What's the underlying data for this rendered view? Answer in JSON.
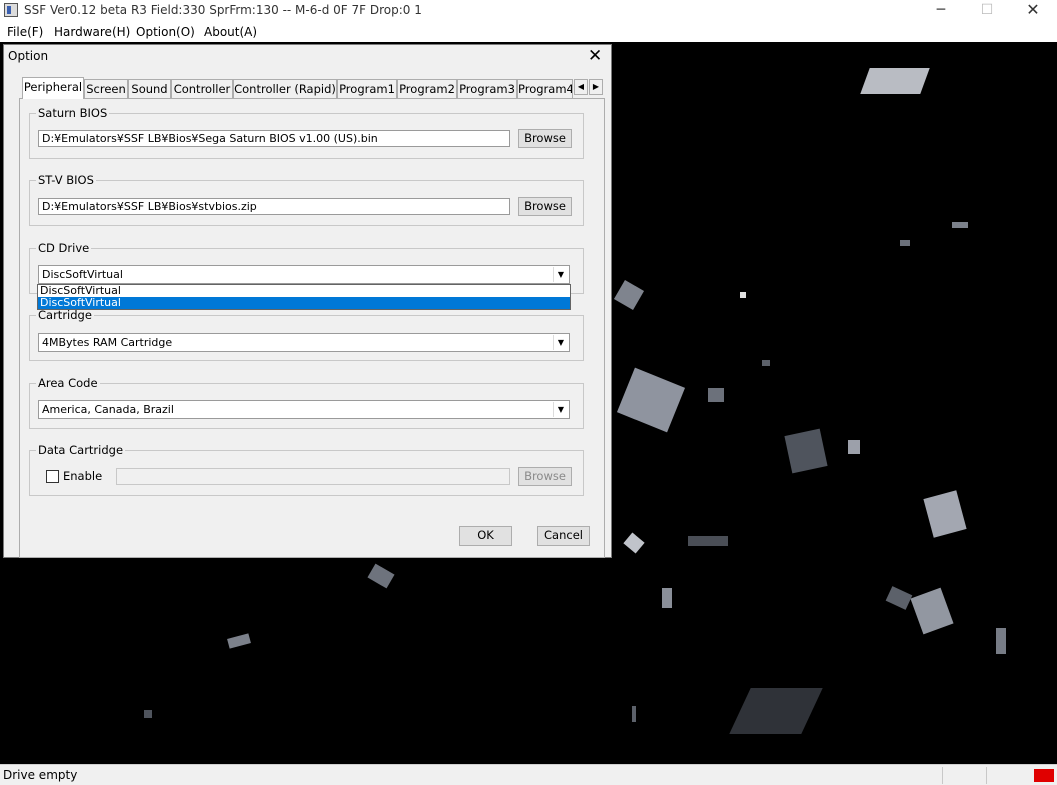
{
  "window": {
    "title": "SSF Ver0.12 beta R3  Field:330  SprFrm:130  -- M-6-d  0F 7F  Drop:0 1",
    "minimize": "─",
    "maximize": "☐",
    "close": "✕"
  },
  "menu": [
    "File(F)",
    "Hardware(H)",
    "Option(O)",
    "About(A)"
  ],
  "dialog": {
    "title": "Option",
    "close": "✕",
    "tabs": [
      "Peripheral",
      "Screen",
      "Sound",
      "Controller",
      "Controller (Rapid)",
      "Program1",
      "Program2",
      "Program3",
      "Program4"
    ],
    "active_tab": "Peripheral",
    "saturn_bios": {
      "label": "Saturn BIOS",
      "path": "D:¥Emulators¥SSF LB¥Bios¥Sega Saturn BIOS v1.00 (US).bin",
      "browse": "Browse"
    },
    "stv_bios": {
      "label": "ST-V BIOS",
      "path": "D:¥Emulators¥SSF LB¥Bios¥stvbios.zip",
      "browse": "Browse"
    },
    "cd_drive": {
      "label": "CD Drive",
      "value": "DiscSoftVirtual",
      "options": [
        "DiscSoftVirtual",
        "DiscSoftVirtual"
      ]
    },
    "cartridge": {
      "label": "Cartridge",
      "value": "4MBytes RAM Cartridge"
    },
    "area_code": {
      "label": "Area Code",
      "value": "America, Canada, Brazil"
    },
    "data_cartridge": {
      "label": "Data Cartridge",
      "enable_label": "Enable",
      "enabled": false,
      "path": "",
      "browse": "Browse"
    },
    "ok": "OK",
    "cancel": "Cancel"
  },
  "status": {
    "text": "Drive empty",
    "indicator_color": "#e00000"
  }
}
